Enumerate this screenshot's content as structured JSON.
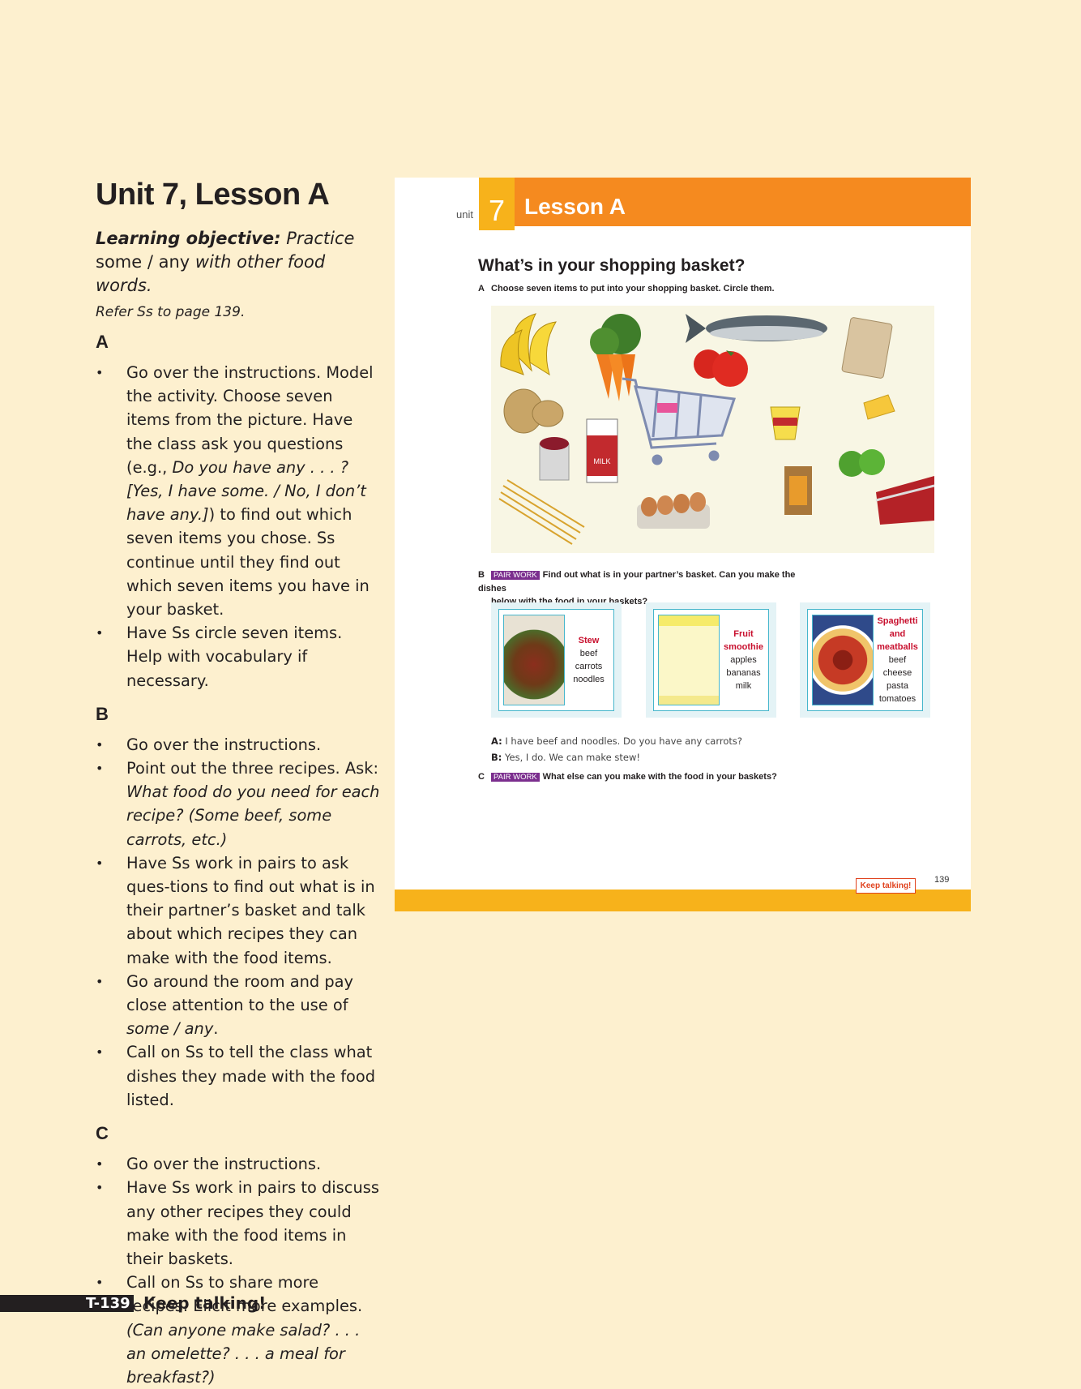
{
  "notes": {
    "title": "Unit 7, Lesson A",
    "objective_label": "Learning objective:",
    "objective_text1": "Practice",
    "objective_text2": "some / any",
    "objective_text3": "with other food words.",
    "refer": "Refer Ss to page 139.",
    "section_a": {
      "heading": "A",
      "b1_part1": "Go over the instructions. Model the activity. Choose seven items from the picture. Have the class ask you questions (e.g.,",
      "b1_italic": "Do you have any . . . ? [Yes, I have some. / No, I don’t have any.]",
      "b1_part2": ") to find out which seven items you chose. Ss continue until they find out which seven items you have in your basket.",
      "b2": "Have Ss circle seven items. Help with vocabulary if necessary."
    },
    "section_b": {
      "heading": "B",
      "b1": "Go over the instructions.",
      "b2_part1": "Point out the three recipes. Ask:",
      "b2_italic": "What food do you need for each recipe? (Some beef, some carrots, etc.)",
      "b3": "Have Ss work in pairs to ask ques-tions to find out what is in their partner’s basket and talk about which recipes they can make with the food items.",
      "b4_part1": "Go around the room and pay close attention to the use of",
      "b4_italic": "some / any",
      "b4_part2": ".",
      "b5": "Call on Ss to tell the class what dishes they made with the food listed."
    },
    "section_c": {
      "heading": "C",
      "b1": "Go over the instructions.",
      "b2": "Have Ss work in pairs to discuss any other recipes they could make with the food items in their baskets.",
      "b3_part1": "Call on Ss to share more recipes. Elicit more examples.",
      "b3_italic": "(Can anyone make salad? . . . an omelette? . . . a meal for breakfast?)"
    }
  },
  "footer": {
    "code": "T-139",
    "title": "Keep talking!"
  },
  "student_book": {
    "unit_label": "unit",
    "unit_number": "7",
    "lesson_title": "Lesson A",
    "question": "What’s in your shopping basket?",
    "exercise_a": {
      "letter": "A",
      "text": "Choose seven items to put into your shopping basket. Circle them."
    },
    "exercise_b": {
      "letter": "B",
      "badge": "PAIR WORK",
      "text_line1": "Find out what is in your partner’s basket. Can you make the dishes",
      "text_line2": "below with the food in your baskets?"
    },
    "recipes": [
      {
        "name": "Stew",
        "items": [
          "beef",
          "carrots",
          "noodles"
        ]
      },
      {
        "name": "Fruit smoothie",
        "items": [
          "apples",
          "bananas",
          "milk"
        ]
      },
      {
        "name": "Spaghetti and meatballs",
        "items": [
          "beef",
          "cheese",
          "pasta",
          "tomatoes"
        ]
      }
    ],
    "dialog": [
      {
        "speaker": "A:",
        "line": "I have beef and noodles. Do you have any carrots?"
      },
      {
        "speaker": "B:",
        "line": "Yes, I do. We can make stew!"
      }
    ],
    "exercise_c": {
      "letter": "C",
      "badge": "PAIR WORK",
      "text": "What else can you make with the food in your baskets?"
    },
    "keep_talking_badge": "Keep talking!",
    "page_number": "139",
    "milk_label": "MILK"
  }
}
